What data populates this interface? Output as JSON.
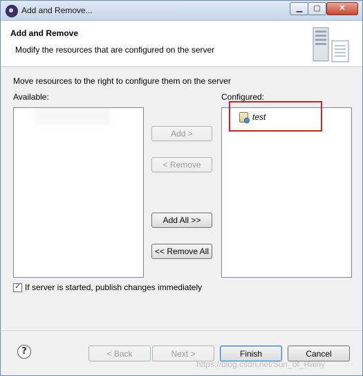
{
  "window": {
    "title": "Add and Remove..."
  },
  "titlebar": {
    "min_icon": "minimize-icon",
    "max_icon": "maximize-icon",
    "close_icon": "close-icon",
    "min_glyph": "▁",
    "max_glyph": "▢",
    "close_glyph": "✕"
  },
  "header": {
    "title": "Add and Remove",
    "description": "Modify the resources that are configured on the server",
    "image_icon": "server-wizard-icon"
  },
  "main": {
    "instruction": "Move resources to the right to configure them on the server",
    "available_label": "Available:",
    "configured_label": "Configured:",
    "available_items": [],
    "configured_items": [
      {
        "label": "test",
        "icon": "project-icon"
      }
    ]
  },
  "buttons": {
    "add": "Add >",
    "remove": "< Remove",
    "add_all": "Add All >>",
    "remove_all": "<< Remove All"
  },
  "options": {
    "publish_label": "If server is started, publish changes immediately",
    "publish_checked": true
  },
  "footer": {
    "help_glyph": "?",
    "back": "< Back",
    "next": "Next >",
    "finish": "Finish",
    "cancel": "Cancel"
  },
  "watermark": "https://blog.csdn.net/Sun_of_Rainy",
  "colors": {
    "highlight": "#d61e26",
    "titlebar": "#c6d6ea",
    "close": "#c8452e"
  }
}
